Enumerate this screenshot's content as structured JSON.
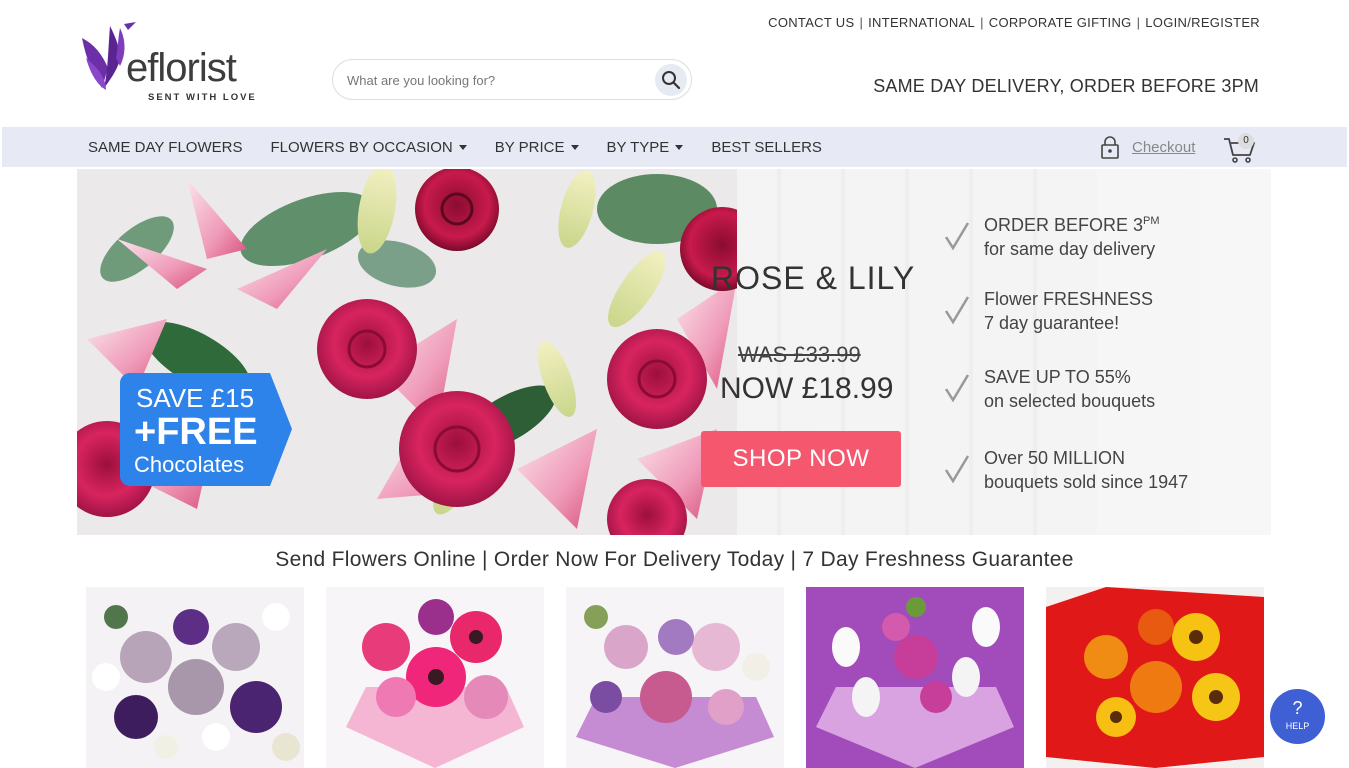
{
  "brand": {
    "name": "eflorist",
    "tagline": "SENT WITH LOVE",
    "color": "#6b2fa8"
  },
  "toplinks": [
    "CONTACT US",
    "INTERNATIONAL",
    "CORPORATE GIFTING",
    "LOGIN/REGISTER"
  ],
  "search": {
    "placeholder": "What are you looking for?"
  },
  "delivery_note": "SAME DAY DELIVERY, ORDER BEFORE 3PM",
  "nav": {
    "items": [
      {
        "label": "SAME DAY FLOWERS",
        "dropdown": false
      },
      {
        "label": "FLOWERS BY OCCASION",
        "dropdown": true
      },
      {
        "label": "BY PRICE",
        "dropdown": true
      },
      {
        "label": "BY TYPE",
        "dropdown": true
      },
      {
        "label": "BEST SELLERS",
        "dropdown": false
      }
    ],
    "checkout_label": "Checkout",
    "cart_count": "0"
  },
  "hero": {
    "badge_line1": "SAVE £15",
    "badge_line2": "+FREE",
    "badge_line3": "Chocolates",
    "product_name": "ROSE & LILY",
    "was_price": "WAS £33.99",
    "now_price": "NOW £18.99",
    "cta": "SHOP NOW",
    "usps": [
      {
        "line1": "ORDER BEFORE 3",
        "line1_sup": "PM",
        "line2": "for same day delivery"
      },
      {
        "line1": "Flower FRESHNESS",
        "line1_sup": "",
        "line2": "7 day guarantee!"
      },
      {
        "line1": "SAVE UP TO 55%",
        "line1_sup": "",
        "line2": "on selected bouquets"
      },
      {
        "line1": "Over 50 MILLION",
        "line1_sup": "",
        "line2": "bouquets sold since 1947"
      }
    ],
    "accent": "#f5576f",
    "badge_color": "#2e83ea"
  },
  "tagline": "Send Flowers Online | Order Now For Delivery Today | 7 Day Freshness Guarantee",
  "products": [
    {
      "icon": "bouquet-purple-white"
    },
    {
      "icon": "bouquet-pink-gerbera"
    },
    {
      "icon": "bouquet-pink-lilac"
    },
    {
      "icon": "bouquet-purple-white-roses"
    },
    {
      "icon": "bouquet-orange-sunflower"
    }
  ],
  "help": {
    "label": "HELP",
    "symbol": "?"
  }
}
